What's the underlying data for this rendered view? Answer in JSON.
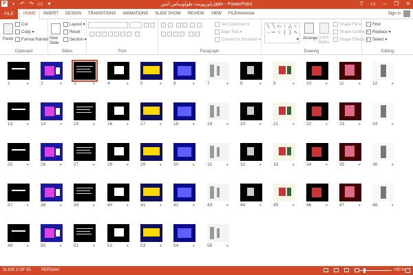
{
  "titlebar": {
    "title": "پاورپوینت طولوساس انس.pptx - PowerPoint",
    "help": "?",
    "minimize": "–",
    "restore": "❐",
    "close": "✕"
  },
  "tabs": {
    "file": "FILE",
    "items": [
      "HOME",
      "INSERT",
      "DESIGN",
      "TRANSITIONS",
      "ANIMATIONS",
      "SLIDE SHOW",
      "REVIEW",
      "VIEW",
      "FILEminimizer"
    ],
    "active": "HOME",
    "signin": "Sign in"
  },
  "ribbon": {
    "clipboard": {
      "label": "Clipboard",
      "paste": "Paste",
      "cut": "Cut",
      "copy": "Copy",
      "format_painter": "Format Painter"
    },
    "slides": {
      "label": "Slides",
      "new_slide": "New Slide",
      "layout": "Layout",
      "reset": "Reset",
      "section": "Section"
    },
    "font": {
      "label": "Font"
    },
    "paragraph": {
      "label": "Paragraph",
      "text_direction": "Text Direction",
      "align_text": "Align Text",
      "convert_smartart": "Convert to SmartArt"
    },
    "drawing": {
      "label": "Drawing",
      "arrange": "Arrange",
      "quick_styles": "Quick Styles",
      "shape_fill": "Shape Fill",
      "shape_outline": "Shape Outline",
      "shape_effects": "Shape Effects"
    },
    "editing": {
      "label": "Editing",
      "find": "Find",
      "replace": "Replace",
      "select": "Select"
    }
  },
  "slides": {
    "selected": 3,
    "numbers": [
      "1",
      "2",
      "3",
      "4",
      "5",
      "6",
      "7",
      "8",
      "9",
      "10",
      "11",
      "12",
      "13",
      "14",
      "15",
      "16",
      "17",
      "18",
      "19",
      "20",
      "21",
      "22",
      "23",
      "24",
      "25",
      "26",
      "27",
      "28",
      "29",
      "30",
      "31",
      "32",
      "33",
      "34",
      "35",
      "36",
      "37",
      "38",
      "39",
      "40",
      "41",
      "42",
      "43",
      "44",
      "45",
      "46",
      "47",
      "48",
      "49",
      "50",
      "51",
      "52",
      "53",
      "54",
      "55"
    ],
    "star": "★"
  },
  "status": {
    "slide_of": "SLIDE 3 OF 55",
    "language": "PERSIAN",
    "zoom_pct": "30 %",
    "zoom_level": 0.3
  },
  "colors": {
    "accent": "#d24726"
  }
}
